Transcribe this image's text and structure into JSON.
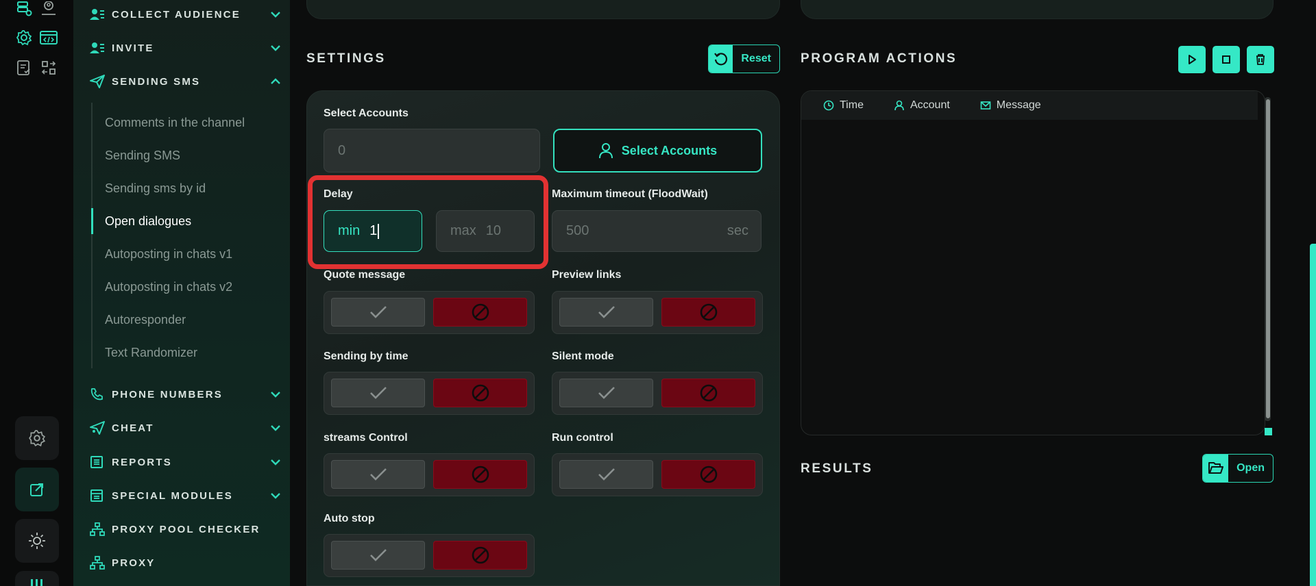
{
  "sidebar": {
    "nav": {
      "collect_audience": "COLLECT AUDIENCE",
      "invite": "INVITE",
      "sending_sms": "SENDING SMS",
      "phone_numbers": "PHONE NUMBERS",
      "cheat": "CHEAT",
      "reports": "REPORTS",
      "special_modules": "SPECIAL MODULES",
      "proxy_pool_checker": "PROXY POOL CHECKER",
      "proxy": "PROXY"
    },
    "sub_items": [
      "Comments in the channel",
      "Sending SMS",
      "Sending sms by id",
      "Open dialogues",
      "Autoposting in chats v1",
      "Autoposting in chats v2",
      "Autoresponder",
      "Text Randomizer"
    ],
    "active_sub_item": "Open dialogues"
  },
  "settings": {
    "title": "SETTINGS",
    "reset_label": "Reset",
    "select_accounts_label": "Select Accounts",
    "accounts_count_placeholder": "0",
    "select_accounts_button": "Select Accounts",
    "delay_label": "Delay",
    "delay_min_prefix": "min",
    "delay_min_value": "1",
    "delay_max_prefix": "max",
    "delay_max_placeholder": "10",
    "max_timeout_label": "Maximum timeout (FloodWait)",
    "max_timeout_placeholder": "500",
    "max_timeout_unit": "sec",
    "quote_message_label": "Quote message",
    "preview_links_label": "Preview links",
    "sending_by_time_label": "Sending by time",
    "silent_mode_label": "Silent mode",
    "streams_control_label": "streams Control",
    "run_control_label": "Run control",
    "auto_stop_label": "Auto stop"
  },
  "program_actions": {
    "title": "PROGRAM ACTIONS",
    "columns": [
      "Time",
      "Account",
      "Message"
    ]
  },
  "results": {
    "title": "RESULTS",
    "open_label": "Open"
  },
  "colors": {
    "accent": "#35e8c6",
    "danger": "#6b0613",
    "highlight": "#e23232"
  }
}
